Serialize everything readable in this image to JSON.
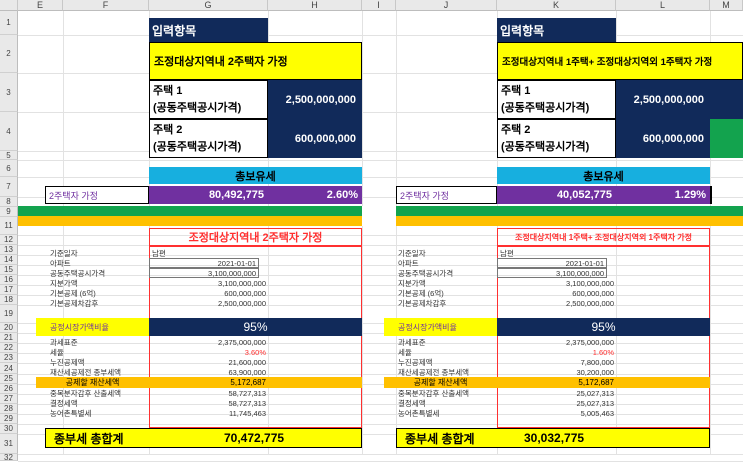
{
  "columns": [
    "E",
    "F",
    "G",
    "H",
    "I",
    "J",
    "K",
    "L",
    "M"
  ],
  "rows": [
    "1",
    "2",
    "3",
    "4",
    "5",
    "6",
    "7",
    "8",
    "9",
    "10",
    "11",
    "12",
    "13",
    "14",
    "15",
    "16",
    "17",
    "18",
    "19",
    "20",
    "21",
    "22",
    "23",
    "24",
    "25",
    "26",
    "27",
    "28",
    "29",
    "30",
    "31",
    "32"
  ],
  "input_header": "입력항목",
  "left": {
    "scenario": "조정대상지역내 2주택자 가정",
    "house1_label_1": "주택 1",
    "house1_label_2": "(공동주택공시가격)",
    "house1_value": "2,500,000,000",
    "house2_label_1": "주택 2",
    "house2_label_2": "(공동주택공시가격)",
    "house2_value": "600,000,000",
    "total_tax_header": "총보유세",
    "assume_label": "2주택자 가정",
    "assume_value": "80,492,775",
    "assume_pct": "2.60%",
    "detail_title": "조정대상지역내 2주택자 가정",
    "rows": [
      {
        "label": "기준일자",
        "value": "남편",
        "align": "left"
      },
      {
        "label": "아파트",
        "value": "2021-01-01",
        "align": "right"
      },
      {
        "label": "공동주택공시가격",
        "value": "3,100,000,000",
        "align": "right"
      },
      {
        "label": "지분가액",
        "value": "3,100,000,000",
        "align": "right"
      },
      {
        "label": "기본공제 (6억)",
        "value": "600,000,000",
        "align": "right"
      },
      {
        "label": "기본공제차감후",
        "value": "2,500,000,000",
        "align": "right"
      }
    ],
    "ratio_label": "공정시장가액비율",
    "ratio_value": "95%",
    "rows2": [
      {
        "label": "과세표준",
        "value": "2,375,000,000",
        "red": false
      },
      {
        "label": "세율",
        "value": "3.60%",
        "red": true
      },
      {
        "label": "누진공제액",
        "value": "21,600,000",
        "red": false
      },
      {
        "label": "재산세공제전 종부세액",
        "value": "63,900,000",
        "red": false
      }
    ],
    "deduct_label": "공제할 재산세액",
    "deduct_value": "5,172,687",
    "rows3": [
      {
        "label": "중복분자감후 산출세액",
        "value": "58,727,313"
      },
      {
        "label": "결정세액",
        "value": "58,727,313"
      },
      {
        "label": "농어촌특별세",
        "value": "11,745,463"
      }
    ],
    "total_label": "종부세 총합계",
    "total_value": "70,472,775"
  },
  "right": {
    "scenario": "조정대상지역내 1주택+ 조정대상지역외 1주택자 가정",
    "house1_label_1": "주택 1",
    "house1_label_2": "(공동주택공시가격)",
    "house1_value": "2,500,000,000",
    "house2_label_1": "주택 2",
    "house2_label_2": "(공동주택공시가격)",
    "house2_value": "600,000,000",
    "total_tax_header": "총보유세",
    "assume_label": "2주택자 가정",
    "assume_value": "40,052,775",
    "assume_pct": "1.29%",
    "detail_title": "조정대상지역내 1주택+ 조정대상지역외 1주택자 가정",
    "rows": [
      {
        "label": "기준일자",
        "value": "남편",
        "align": "left"
      },
      {
        "label": "아파트",
        "value": "2021-01-01",
        "align": "right"
      },
      {
        "label": "공동주택공시가격",
        "value": "3,100,000,000",
        "align": "right"
      },
      {
        "label": "지분가액",
        "value": "3,100,000,000",
        "align": "right"
      },
      {
        "label": "기본공제 (6억)",
        "value": "600,000,000",
        "align": "right"
      },
      {
        "label": "기본공제차감후",
        "value": "2,500,000,000",
        "align": "right"
      }
    ],
    "ratio_label": "공정시장가액비율",
    "ratio_value": "95%",
    "rows2": [
      {
        "label": "과세표준",
        "value": "2,375,000,000",
        "red": false
      },
      {
        "label": "세율",
        "value": "1.60%",
        "red": true
      },
      {
        "label": "누진공제액",
        "value": "7,800,000",
        "red": false
      },
      {
        "label": "재산세공제전 종부세액",
        "value": "30,200,000",
        "red": false
      }
    ],
    "deduct_label": "공제할 재산세액",
    "deduct_value": "5,172,687",
    "rows3": [
      {
        "label": "중복분자감후 산출세액",
        "value": "25,027,313"
      },
      {
        "label": "결정세액",
        "value": "25,027,313"
      },
      {
        "label": "농어촌특별세",
        "value": "5,005,463"
      }
    ],
    "total_label": "종부세 총합계",
    "total_value": "30,032,775"
  },
  "colors": {
    "navy": "#112a5a",
    "yellow": "#ffff00",
    "cyan": "#17afdf",
    "purple": "#7030a0",
    "green": "#13a34e",
    "orange": "#ffc000",
    "red": "#ff3030"
  }
}
